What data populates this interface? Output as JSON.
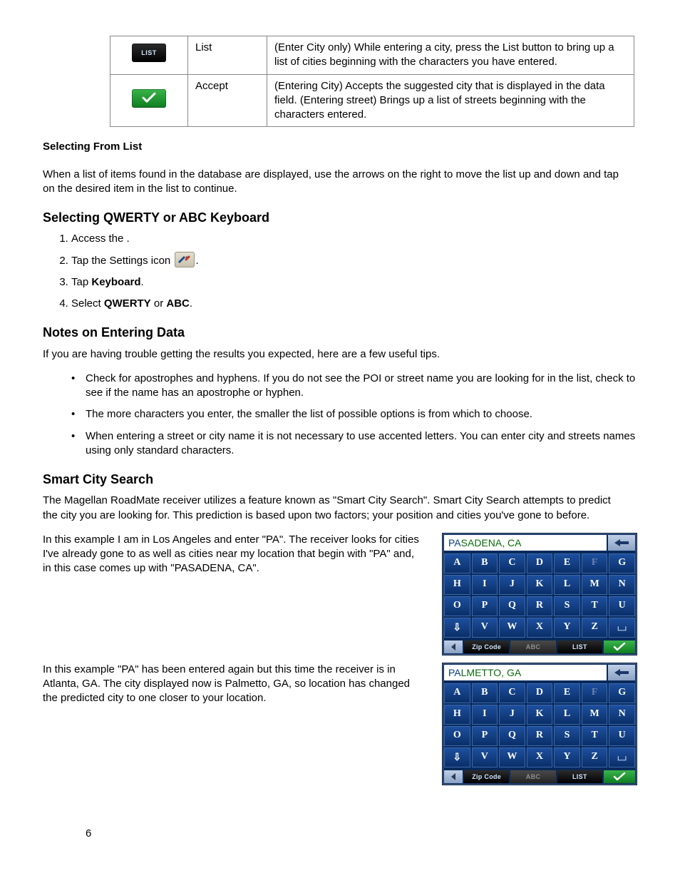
{
  "page_number": "6",
  "button_table": {
    "rows": [
      {
        "icon": "list",
        "icon_label": "LIST",
        "name": "List",
        "desc": "(Enter City only)  While entering a city, press the List button to bring up a list of cities beginning with the characters you have entered."
      },
      {
        "icon": "accept",
        "name": "Accept",
        "desc": "(Entering City)  Accepts the suggested city that is displayed in the data field.  (Entering street) Brings up a list of streets beginning with the characters entered."
      }
    ]
  },
  "selecting_from_list": {
    "heading": "Selecting From List",
    "body": "When a list of items found in the database are displayed, use the arrows on the right to move the list up and down and tap on the desired item in the list to continue."
  },
  "keyboard_select": {
    "heading": "Selecting QWERTY or ABC Keyboard",
    "step1_pre": "Access the ",
    "step1_post": ".",
    "step2_pre": "Tap the Settings icon ",
    "step2_post": ".",
    "step3_pre": "Tap ",
    "step3_bold": "Keyboard",
    "step3_post": ".",
    "step4_pre": "Select ",
    "step4_b1": "QWERTY",
    "step4_mid": " or ",
    "step4_b2": "ABC",
    "step4_post": "."
  },
  "notes": {
    "heading": "Notes on Entering Data",
    "intro": "If you are having trouble getting the results you expected, here are a few useful tips.",
    "tips": [
      "Check for apostrophes and hyphens. If you do not see the POI or street name you are looking for in the list, check to see if the name has an apostrophe or hyphen.",
      "The more characters you enter, the smaller the list of possible options is from which to choose.",
      "When entering a street or city name it is not necessary to use accented letters. You can enter city and streets names using only standard characters."
    ]
  },
  "smart_city": {
    "heading": "Smart City Search",
    "intro": "The Magellan RoadMate receiver utilizes a feature known as \"Smart City Search\".  Smart City Search attempts to predict the city you are looking for.  This prediction is based upon two factors; your position and cities you've gone to before.",
    "ex1_text": "In this example I am in Los Angeles and enter \"PA\".  The receiver looks for cities I've already gone to as well as cities near my location that begin with \"PA\" and, in this case comes up with \"PASADENA, CA\".",
    "ex2_text": "In this example \"PA\" has been entered again but this time the receiver is in Atlanta, GA.  The city displayed now is Palmetto, GA, so location has changed the predicted city to one closer to your location."
  },
  "toolbar": {
    "zip": "Zip Code",
    "abc": "ABC",
    "list": "LIST"
  },
  "keyboards": [
    {
      "typed": "PA",
      "suggest": "SADENA, CA",
      "dim": [
        "F"
      ]
    },
    {
      "typed": "PA",
      "suggest": "LMETTO, GA",
      "dim": [
        "F"
      ]
    }
  ],
  "letters": [
    "A",
    "B",
    "C",
    "D",
    "E",
    "F",
    "G",
    "H",
    "I",
    "J",
    "K",
    "L",
    "M",
    "N",
    "O",
    "P",
    "Q",
    "R",
    "S",
    "T",
    "U",
    "V",
    "W",
    "X",
    "Y",
    "Z"
  ]
}
